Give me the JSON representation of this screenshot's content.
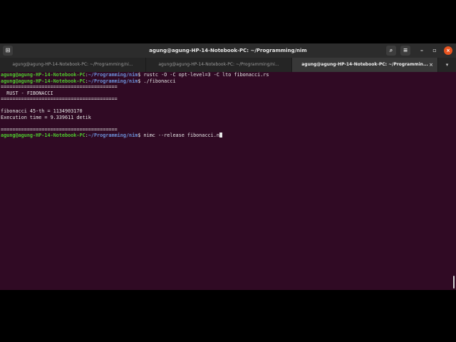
{
  "window": {
    "title": "agung@agung-HP-14-Notebook-PC: ~/Programming/nim",
    "icons": {
      "new_tab": "terminal-icon",
      "search": "search-icon",
      "menu": "hamburger-icon"
    },
    "controls": {
      "minimize": "–",
      "maximize": "▫",
      "close": "×"
    }
  },
  "tabs": [
    {
      "label": "agung@agung-HP-14-Notebook-PC: ~/Programming/ni...",
      "active": false
    },
    {
      "label": "agung@agung-HP-14-Notebook-PC: ~/Programming/ni...",
      "active": false
    },
    {
      "label": "agung@agung-HP-14-Notebook-PC: ~/Programmin...",
      "active": true
    }
  ],
  "tab_close": "×",
  "tab_menu": "▾",
  "colors": {
    "background": "#300a24",
    "prompt_user": "#4ec92e",
    "prompt_path": "#6b8fd6"
  },
  "terminal": {
    "prompt_user": "agung@agung-HP-14-Notebook-PC",
    "prompt_path": "~/Programming/nim",
    "line1_cmd": " rustc -O -C opt-level=3 -C lto fibonacci.rs",
    "line2_cmd": " ./fibonacci",
    "sep1": "========================================",
    "header": "  RUST - FIBONACCI",
    "sep2": "========================================",
    "result": "fibonacci 45-th = 1134903170",
    "time": "Execution time = 9.339611 detik",
    "sep3": "========================================",
    "line3_cmd": " nimc --release fibonacci.n"
  }
}
